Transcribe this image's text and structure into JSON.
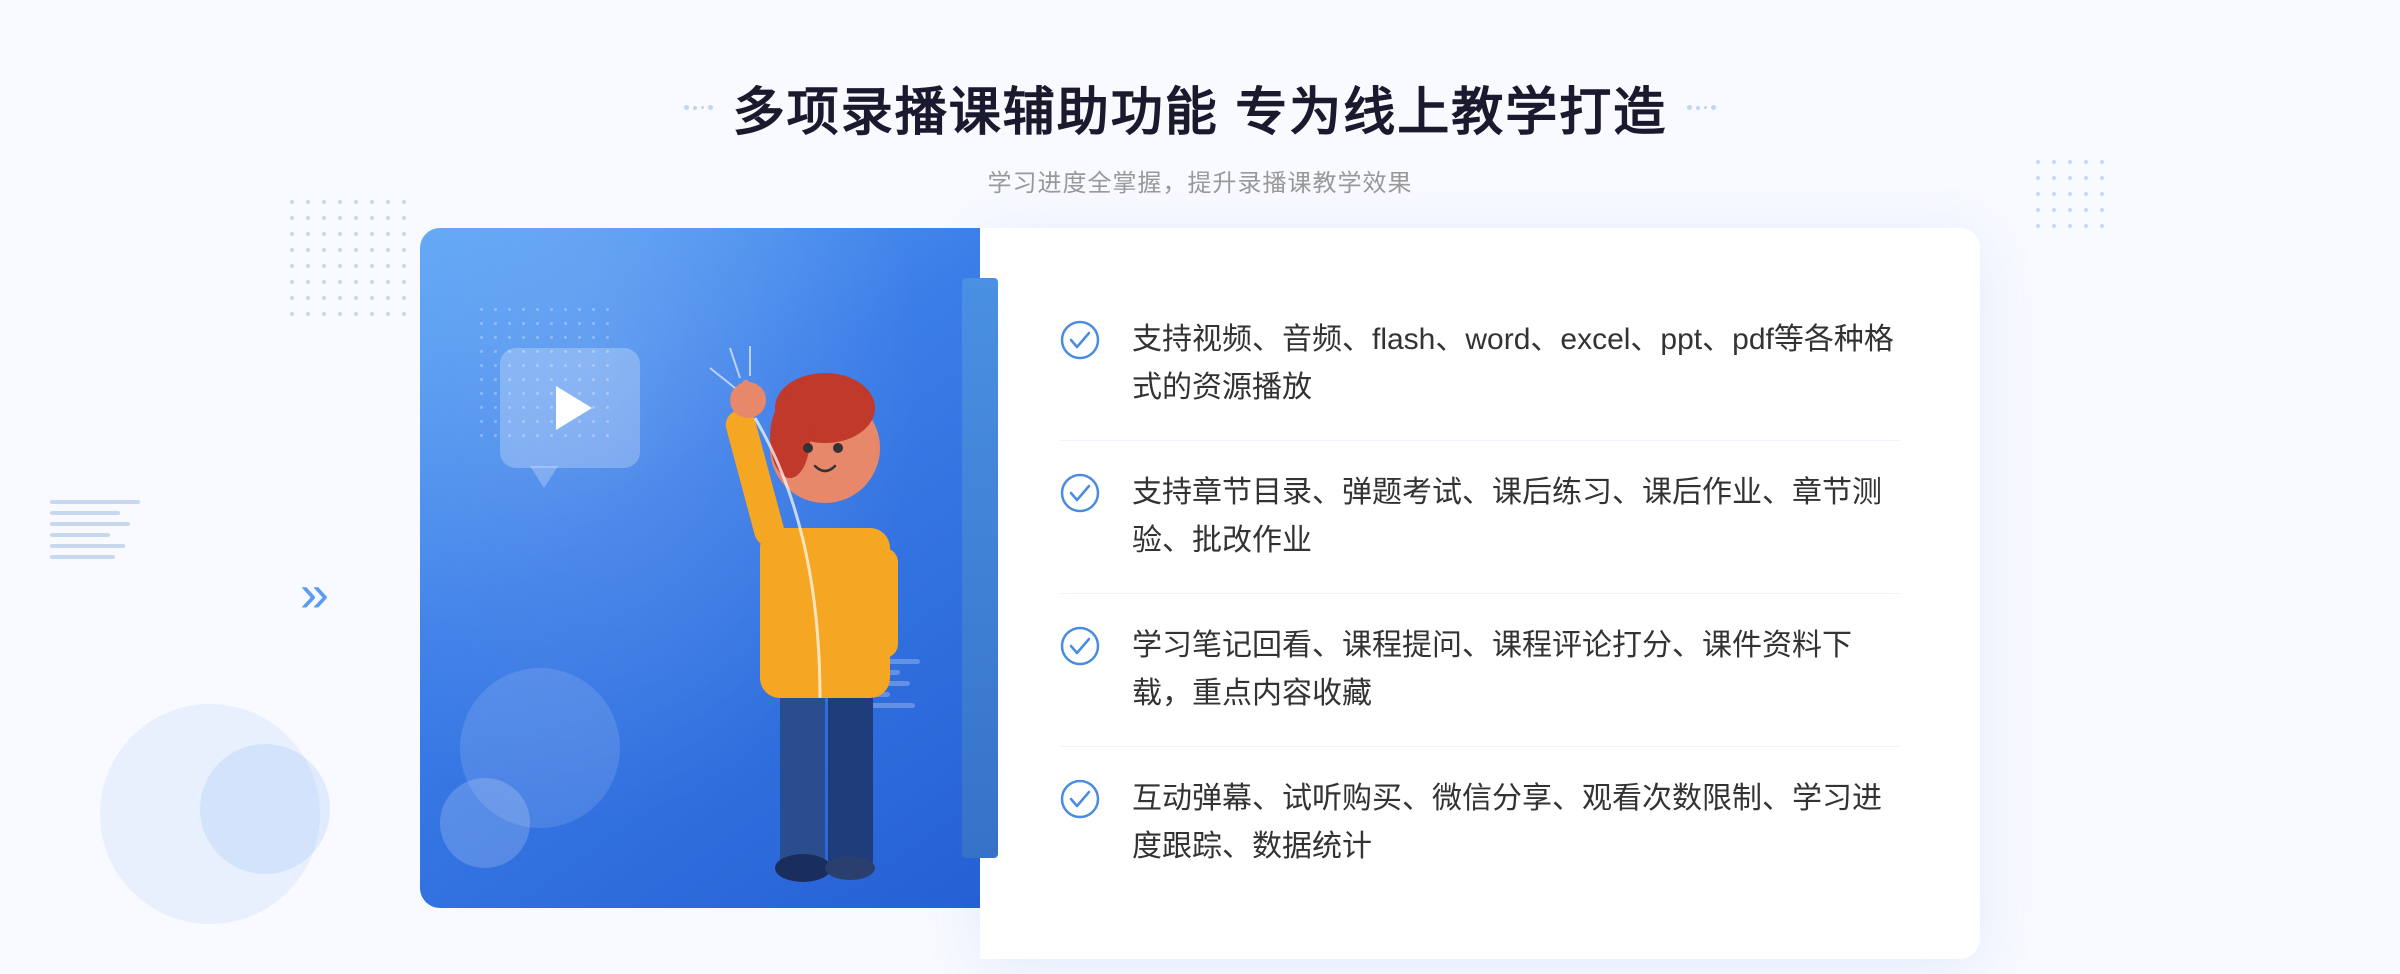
{
  "header": {
    "main_title": "多项录播课辅助功能 专为线上教学打造",
    "subtitle": "学习进度全掌握，提升录播课教学效果",
    "deco_left": "❖",
    "deco_right": "❖"
  },
  "features": [
    {
      "id": "feature-1",
      "text": "支持视频、音频、flash、word、excel、ppt、pdf等各种格式的资源播放"
    },
    {
      "id": "feature-2",
      "text": "支持章节目录、弹题考试、课后练习、课后作业、章节测验、批改作业"
    },
    {
      "id": "feature-3",
      "text": "学习笔记回看、课程提问、课程评论打分、课件资料下载，重点内容收藏"
    },
    {
      "id": "feature-4",
      "text": "互动弹幕、试听购买、微信分享、观看次数限制、学习进度跟踪、数据统计"
    }
  ],
  "colors": {
    "primary_blue": "#3b7de8",
    "light_blue": "#5ba4f5",
    "dark_blue": "#2560d4",
    "check_color": "#4a8de0",
    "text_dark": "#333333",
    "text_gray": "#999999",
    "bg": "#f8faff"
  },
  "chevron": "»",
  "side_chevron": "»"
}
